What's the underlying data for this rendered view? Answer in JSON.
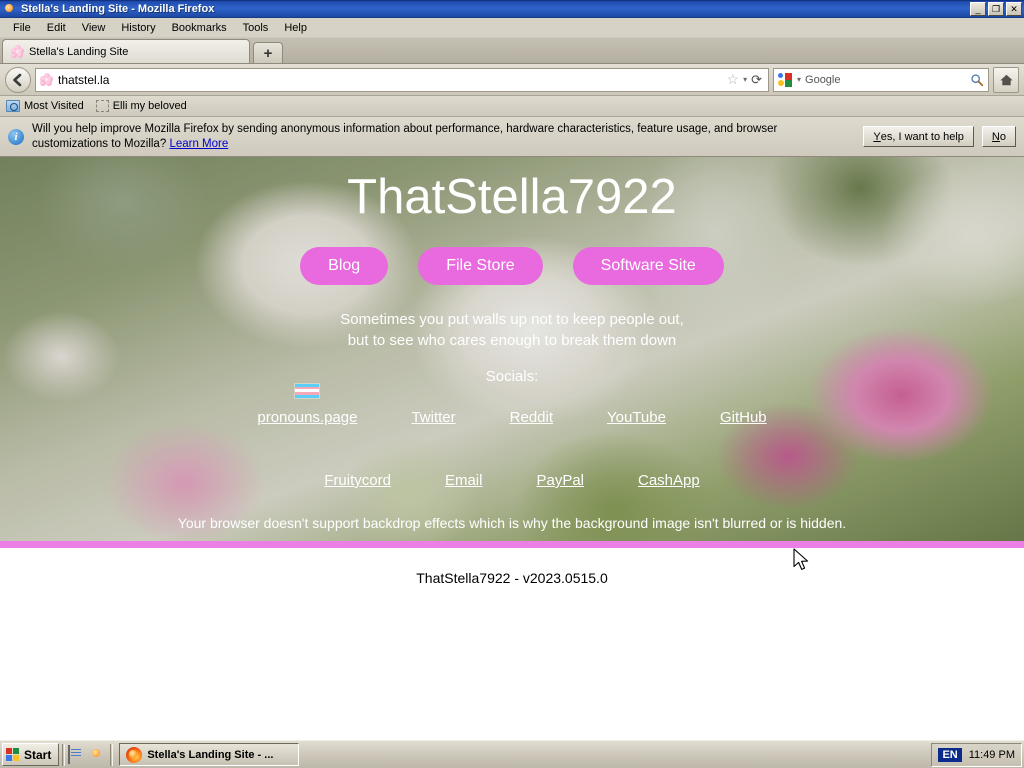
{
  "window": {
    "title": "Stella's Landing Site - Mozilla Firefox",
    "minimize_label": "_",
    "maximize_label": "❐",
    "close_label": "✕"
  },
  "menubar": {
    "items": [
      {
        "label": "File",
        "accel": "F"
      },
      {
        "label": "Edit",
        "accel": "E"
      },
      {
        "label": "View",
        "accel": "V"
      },
      {
        "label": "History",
        "accel": "s"
      },
      {
        "label": "Bookmarks",
        "accel": "B"
      },
      {
        "label": "Tools",
        "accel": "T"
      },
      {
        "label": "Help",
        "accel": "H"
      }
    ]
  },
  "tabs": {
    "active": "Stella's Landing Site",
    "new_tab_label": "+",
    "favicon": "flower-icon"
  },
  "navbar": {
    "back_icon": "back-arrow-icon",
    "site_favicon": "flower-icon",
    "url": "thatstel.la",
    "star_icon": "☆",
    "dropdown_icon": "▾",
    "reload_icon": "⟳",
    "search_engine": "Google",
    "search_engine_icon": "google-icon",
    "search_icon": "magnifier-icon",
    "home_icon": "home-icon"
  },
  "bookmarks": [
    {
      "label": "Most Visited",
      "icon": "folder-search-icon"
    },
    {
      "label": "Elli my beloved",
      "icon": "dashed-box-icon"
    }
  ],
  "notification": {
    "icon": "info-icon",
    "message": "Will you help improve Mozilla Firefox by sending anonymous information about performance, hardware characteristics, feature usage, and browser customizations to Mozilla?",
    "learn_more": "Learn More",
    "yes_label": "Yes, I want to help",
    "yes_accel": "Y",
    "no_label": "No",
    "no_accel": "N"
  },
  "page": {
    "site_title": "ThatStella7922",
    "nav_buttons": [
      {
        "label": "Blog"
      },
      {
        "label": "File Store"
      },
      {
        "label": "Software Site"
      }
    ],
    "quote_line1": "Sometimes you put walls up not to keep people out,",
    "quote_line2": "but to see who cares enough to break them down",
    "socials_label": "Socials:",
    "links_row1": [
      {
        "label": "pronouns.page",
        "badge": "trans-pride-flag-icon"
      },
      {
        "label": "Twitter"
      },
      {
        "label": "Reddit"
      },
      {
        "label": "YouTube"
      },
      {
        "label": "GitHub"
      }
    ],
    "links_row2": [
      {
        "label": "Fruitycord"
      },
      {
        "label": "Email"
      },
      {
        "label": "PayPal"
      },
      {
        "label": "CashApp"
      }
    ],
    "backdrop_note": "Your browser doesn't support backdrop effects which is why the background image isn't blurred or is hidden.",
    "footer": "ThatStella7922 - v2023.0515.0",
    "accent_pink": "#e86ade",
    "divider_pink": "#ec7fe6"
  },
  "taskbar": {
    "start_label": "Start",
    "quick_launch": [
      {
        "icon": "notepad-icon"
      },
      {
        "icon": "firefox-icon"
      }
    ],
    "tasks": [
      {
        "label": "Stella's Landing Site - ...",
        "icon": "firefox-icon"
      }
    ],
    "language": "EN",
    "clock": "11:49 PM"
  }
}
